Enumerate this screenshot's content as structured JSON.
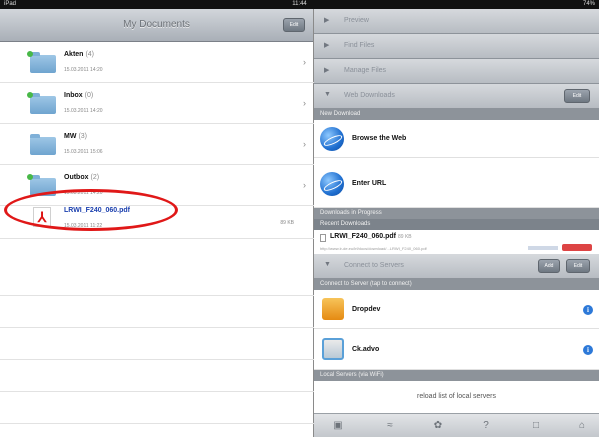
{
  "status_bar": {
    "carrier": "iPad",
    "time": "11:44",
    "battery": "74%"
  },
  "left": {
    "title": "My Documents",
    "edit_label": "Edit",
    "items": [
      {
        "name": "Akten",
        "count": "(4)",
        "date": "15.03.2011 14:20",
        "type": "folder"
      },
      {
        "name": "Inbox",
        "count": "(0)",
        "date": "15.03.2011 14:20",
        "type": "folder"
      },
      {
        "name": "MW",
        "count": "(3)",
        "date": "15.03.2011 15:06",
        "type": "folder"
      },
      {
        "name": "Outbox",
        "count": "(2)",
        "date": "15.03.2011 14:20",
        "type": "folder"
      },
      {
        "name": "LRWI_F240_060.pdf",
        "count": "",
        "date": "15.03.2011 11:22",
        "type": "file",
        "size": "89 KB"
      }
    ]
  },
  "right": {
    "sections": {
      "preview": "Preview",
      "find_files": "Find Files",
      "manage_files": "Manage Files",
      "web_downloads": "Web Downloads",
      "connect_servers": "Connect to Servers"
    },
    "web_downloads_button": "Edit",
    "new_download_header": "New Download",
    "browse_web": "Browse the Web",
    "enter_url": "Enter URL",
    "downloads_in_progress": "Downloads in Progress",
    "recent_downloads": "Recent Downloads",
    "download": {
      "name": "LRWI_F240_060.pdf",
      "size": "89 KB",
      "url": "http://www.lr-de.eu/lrf/docs/download/...LRWI_F240_060.pdf"
    },
    "servers_add": "Add",
    "servers_edit": "Edit",
    "connect_header": "Connect to Server (tap to connect)",
    "servers": [
      {
        "name": "Dropdev",
        "icon": "dropbox-folder-icon",
        "color": "#f3a21d"
      },
      {
        "name": "Ck.advo",
        "icon": "server-icon",
        "color": "#5aa0d8"
      }
    ],
    "local_header": "Local Servers (via WiFi)",
    "reload_label": "reload list of local servers"
  },
  "toolbar_icons": [
    "camera-icon",
    "wifi-icon",
    "settings-icon",
    "help-icon",
    "share-icon",
    "lock-icon"
  ]
}
